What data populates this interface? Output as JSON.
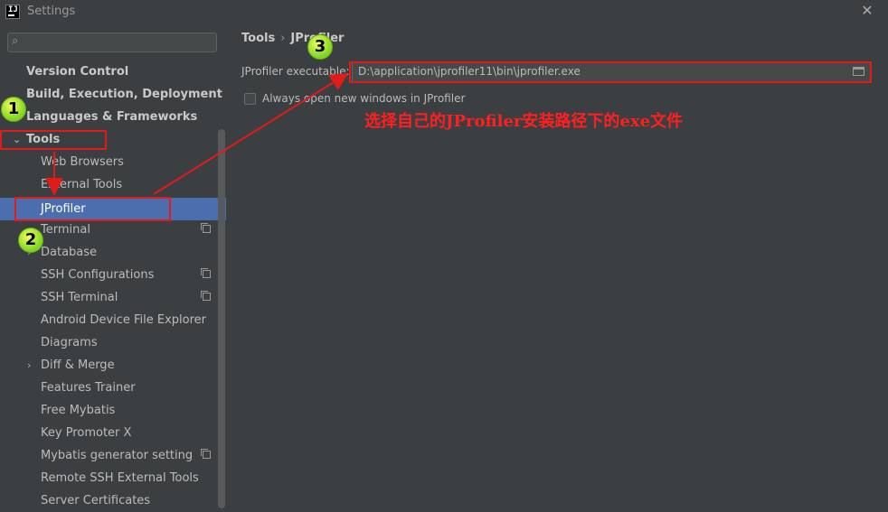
{
  "window": {
    "title": "Settings",
    "logo_text": "IJ"
  },
  "search": {
    "placeholder": "",
    "value": ""
  },
  "sidebar": {
    "items": [
      {
        "label": "Version Control"
      },
      {
        "label": "Build, Execution, Deployment"
      },
      {
        "label": "Languages & Frameworks"
      },
      {
        "label": "Tools"
      },
      {
        "label": "Web Browsers"
      },
      {
        "label": "External Tools"
      },
      {
        "label": "JProfiler"
      },
      {
        "label": "Terminal"
      },
      {
        "label": "Database"
      },
      {
        "label": "SSH Configurations"
      },
      {
        "label": "SSH Terminal"
      },
      {
        "label": "Android Device File Explorer"
      },
      {
        "label": "Diagrams"
      },
      {
        "label": "Diff & Merge"
      },
      {
        "label": "Features Trainer"
      },
      {
        "label": "Free Mybatis"
      },
      {
        "label": "Key Promoter X"
      },
      {
        "label": "Mybatis generator setting"
      },
      {
        "label": "Remote SSH External Tools"
      },
      {
        "label": "Server Certificates"
      }
    ]
  },
  "main": {
    "breadcrumb": {
      "parent": "Tools",
      "current": "JProfiler",
      "separator": "›"
    },
    "executable_label": "JProfiler executable:",
    "executable_value": "D:\\application\\jprofiler11\\bin\\jprofiler.exe",
    "always_open_label": "Always open new windows in JProfiler",
    "always_open_checked": false
  },
  "annotations": {
    "note": "选择自己的JProfiler安装路径下的exe文件",
    "step1": "1",
    "step2": "2",
    "step3": "3"
  },
  "colors": {
    "background": "#3c3f41",
    "selection": "#4b6eaf",
    "annotation_red": "#e21a1a",
    "badge_green": "#7bd322"
  }
}
